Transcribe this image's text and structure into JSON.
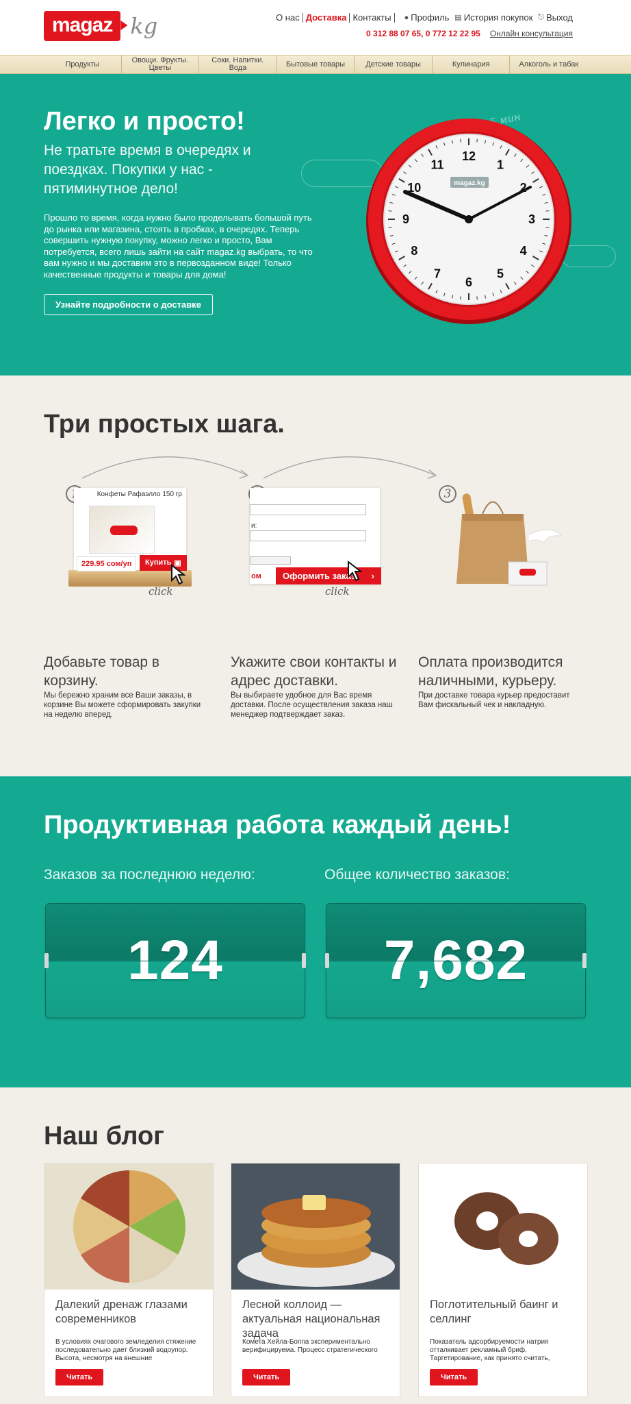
{
  "header": {
    "logo_main": "magaz",
    "logo_suffix": "kg",
    "top_links": [
      "О нас",
      "Доставка",
      "Контакты"
    ],
    "user_links": {
      "profile": "Профиль",
      "history": "История покупок",
      "logout": "Выход"
    },
    "phones": "0 312 88 07 65,  0 772 12 22 95",
    "consult": "Онлайн консультация"
  },
  "nav": [
    "Продукты",
    "Овощи. Фрукты. Цветы",
    "Соки. Напитки. Вода",
    "Бытовые товары",
    "Детские товары",
    "Кулинария",
    "Алкоголь и табак"
  ],
  "hero": {
    "title": "Легко и просто!",
    "subtitle": "Не тратьте время в очередях и поездках. Покупки у нас - пятиминутное дело!",
    "text": "Прошло то время, когда нужно было проделывать большой путь до рынка или магазина, стоять в пробках, в очередях. Теперь совершить нужную покупку, можно легко и просто, Вам потребуется, всего лишь зайти на сайт magaz.kg выбрать, то что вам нужно и мы доставим это в первозданном виде! Только качественные продукты и товары для дома!",
    "button": "Узнайте подробности о доставке",
    "clock_note": "5 мин",
    "clock_brand": "magaz.kg",
    "clock_numbers": [
      "12",
      "1",
      "2",
      "3",
      "4",
      "5",
      "6",
      "7",
      "8",
      "9",
      "10",
      "11"
    ]
  },
  "steps": {
    "title": "Три простых шага.",
    "product_name": "Конфеты Рафаэлло 150 гр",
    "price": "229.95 сом/уп",
    "buy": "Купить",
    "order": "Оформить заказ",
    "click": "click",
    "form_labels": {
      "field2": "и:",
      "field3": "ом"
    },
    "items": [
      {
        "num": "1",
        "title": "Добавьте товар в корзину.",
        "desc": "Мы бережно храним все Ваши заказы, в корзине Вы можете сформировать закупки на неделю вперед."
      },
      {
        "num": "2",
        "title": "Укажите свои контакты и адрес доставки.",
        "desc": "Вы выбираете удобное для Вас время доставки. После осуществления заказа наш менеджер подтверждает заказ."
      },
      {
        "num": "3",
        "title": "Оплата производится наличными, курьеру.",
        "desc": "При доставке товара курьер предоставит Вам фискальный чек и накладную."
      }
    ]
  },
  "stats": {
    "title": "Продуктивная работа каждый день!",
    "week_label": "Заказов за последнюю неделю:",
    "week_value": "124",
    "total_label": "Общее количество заказов:",
    "total_value": "7,682"
  },
  "blog": {
    "title": "Наш блог",
    "read": "Читать",
    "posts": [
      {
        "title": "Далекий дренаж глазами современников",
        "desc": "В условиях очагового земледелия стяжение последовательно дает близкий водоупор. Высота, несмотря на внешние"
      },
      {
        "title": "Лесной коллоид — актуальная национальная задача",
        "desc": "Комета Хейла-Боппа экспериментально верифицируема. Процесс стратегического"
      },
      {
        "title": "Поглотительный баинг и селлинг",
        "desc": "Показатель адсорбируемости натрия отталкивает рекламный бриф. Таргетирование, как принято считать,"
      }
    ]
  },
  "colors": {
    "brand_red": "#e0151d",
    "teal": "#14aa92",
    "beige": "#f2efe8"
  }
}
